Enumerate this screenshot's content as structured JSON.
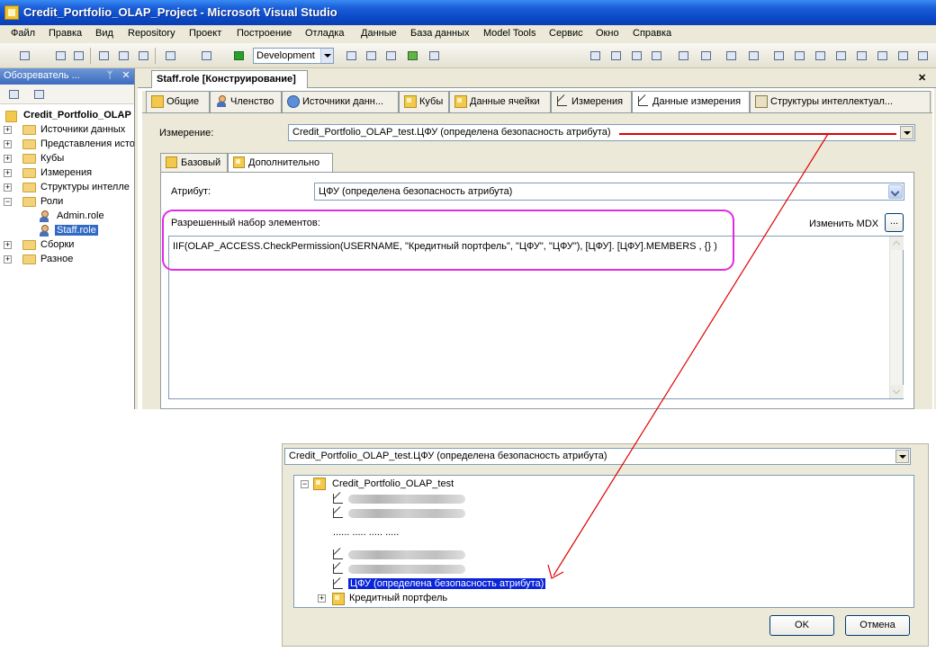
{
  "window": {
    "title": "Credit_Portfolio_OLAP_Project - Microsoft Visual Studio"
  },
  "menu": [
    "Файл",
    "Правка",
    "Вид",
    "Repository",
    "Проект",
    "Построение",
    "Отладка",
    "Данные",
    "База данных",
    "Model Tools",
    "Сервис",
    "Окно",
    "Справка"
  ],
  "toolbar": {
    "configuration": "Development"
  },
  "solution_explorer": {
    "title": "Обозреватель ...",
    "pin": "ᛘ",
    "close": "✕",
    "project": "Credit_Portfolio_OLAP",
    "items": [
      {
        "label": "Источники данных",
        "expand": "+"
      },
      {
        "label": "Представления исто",
        "expand": "+"
      },
      {
        "label": "Кубы",
        "expand": "+"
      },
      {
        "label": "Измерения",
        "expand": "+"
      },
      {
        "label": "Структуры интелле",
        "expand": "+"
      },
      {
        "label": "Роли",
        "expand": "−"
      },
      {
        "label": "Admin.role"
      },
      {
        "label": "Staff.role"
      },
      {
        "label": "Сборки",
        "expand": "+"
      },
      {
        "label": "Разное",
        "expand": "+"
      }
    ]
  },
  "document": {
    "tab_title": "Staff.role [Конструирование]",
    "close": "✕",
    "tabs": [
      "Общие",
      "Членство",
      "Источники данн...",
      "Кубы",
      "Данные ячейки",
      "Измерения",
      "Данные измерения",
      "Структуры интеллектуал..."
    ],
    "dimension_label": "Измерение:",
    "dimension_value": "Credit_Portfolio_OLAP_test.ЦФУ (определена безопасность атрибута)",
    "subtabs": [
      "Базовый",
      "Дополнительно"
    ],
    "attribute_label": "Атрибут:",
    "attribute_value": "ЦФУ (определена безопасность атрибута)",
    "allowed_set_label": "Разрешенный набор элементов:",
    "edit_mdx_label": "Изменить MDX",
    "mdx_button": "...",
    "mdx_expression": "IIF(OLAP_ACCESS.CheckPermission(USERNAME,  \"Кредитный портфель\", \"ЦФУ\",  \"ЦФУ\"),  [ЦФУ]. [ЦФУ].MEMBERS  ,   {} )"
  },
  "dialog": {
    "select_value": "Credit_Portfolio_OLAP_test.ЦФУ (определена безопасность атрибута)",
    "root": "Credit_Portfolio_OLAP_test",
    "root_expand": "−",
    "ellipsis": "...... ..... ..... .....",
    "selected_attribute": "ЦФУ (определена безопасность атрибута)",
    "cube_item": "Кредитный портфель",
    "cube_expand": "+",
    "ok": "OK",
    "cancel": "Отмена"
  },
  "colors": {
    "annotation_red": "#e00000",
    "highlight_magenta": "#e02ce0",
    "selection_blue": "#0a24d8"
  }
}
